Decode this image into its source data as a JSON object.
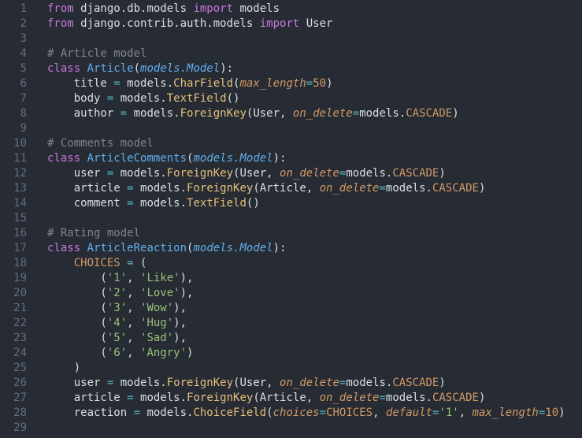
{
  "editor": {
    "language": "python",
    "colors": {
      "background": "#272b33",
      "line_number": "#636d83",
      "default": "#dcdfe4",
      "keyword": "#c678dd",
      "comment": "#7f848e",
      "class_name": "#61afef",
      "call": "#e5c07b",
      "number": "#d19a66",
      "string": "#98c379",
      "operator": "#56b6c2"
    },
    "lines": [
      {
        "n": "1",
        "tokens": [
          [
            "k",
            "from"
          ],
          [
            "d",
            " django.db.models "
          ],
          [
            "k",
            "import"
          ],
          [
            "d",
            " models"
          ]
        ]
      },
      {
        "n": "2",
        "tokens": [
          [
            "k",
            "from"
          ],
          [
            "d",
            " django.contrib.auth.models "
          ],
          [
            "k",
            "import"
          ],
          [
            "d",
            " User"
          ]
        ]
      },
      {
        "n": "3",
        "tokens": []
      },
      {
        "n": "4",
        "tokens": [
          [
            "c",
            "# Article model"
          ]
        ]
      },
      {
        "n": "5",
        "tokens": [
          [
            "k",
            "class"
          ],
          [
            "d",
            " "
          ],
          [
            "f",
            "Article"
          ],
          [
            "d",
            "("
          ],
          [
            "bi",
            "models.Model"
          ],
          [
            "d",
            "):"
          ]
        ]
      },
      {
        "n": "6",
        "tokens": [
          [
            "d",
            "    title "
          ],
          [
            "e",
            "="
          ],
          [
            "d",
            " models."
          ],
          [
            "b",
            "CharField"
          ],
          [
            "d",
            "("
          ],
          [
            "p",
            "max_length"
          ],
          [
            "e",
            "="
          ],
          [
            "y",
            "50"
          ],
          [
            "d",
            ")"
          ]
        ]
      },
      {
        "n": "7",
        "tokens": [
          [
            "d",
            "    body "
          ],
          [
            "e",
            "="
          ],
          [
            "d",
            " models."
          ],
          [
            "b",
            "TextField"
          ],
          [
            "d",
            "()"
          ]
        ]
      },
      {
        "n": "8",
        "tokens": [
          [
            "d",
            "    author "
          ],
          [
            "e",
            "="
          ],
          [
            "d",
            " models."
          ],
          [
            "b",
            "ForeignKey"
          ],
          [
            "d",
            "(User, "
          ],
          [
            "p",
            "on_delete"
          ],
          [
            "e",
            "="
          ],
          [
            "d",
            "models."
          ],
          [
            "y",
            "CASCADE"
          ],
          [
            "d",
            ")"
          ]
        ]
      },
      {
        "n": "9",
        "tokens": []
      },
      {
        "n": "10",
        "tokens": [
          [
            "c",
            "# Comments model"
          ]
        ]
      },
      {
        "n": "11",
        "tokens": [
          [
            "k",
            "class"
          ],
          [
            "d",
            " "
          ],
          [
            "f",
            "ArticleComments"
          ],
          [
            "d",
            "("
          ],
          [
            "bi",
            "models.Model"
          ],
          [
            "d",
            "):"
          ]
        ]
      },
      {
        "n": "12",
        "tokens": [
          [
            "d",
            "    user "
          ],
          [
            "e",
            "="
          ],
          [
            "d",
            " models."
          ],
          [
            "b",
            "ForeignKey"
          ],
          [
            "d",
            "(User, "
          ],
          [
            "p",
            "on_delete"
          ],
          [
            "e",
            "="
          ],
          [
            "d",
            "models."
          ],
          [
            "y",
            "CASCADE"
          ],
          [
            "d",
            ")"
          ]
        ]
      },
      {
        "n": "13",
        "tokens": [
          [
            "d",
            "    article "
          ],
          [
            "e",
            "="
          ],
          [
            "d",
            " models."
          ],
          [
            "b",
            "ForeignKey"
          ],
          [
            "d",
            "(Article, "
          ],
          [
            "p",
            "on_delete"
          ],
          [
            "e",
            "="
          ],
          [
            "d",
            "models."
          ],
          [
            "y",
            "CASCADE"
          ],
          [
            "d",
            ")"
          ]
        ]
      },
      {
        "n": "14",
        "tokens": [
          [
            "d",
            "    comment "
          ],
          [
            "e",
            "="
          ],
          [
            "d",
            " models."
          ],
          [
            "b",
            "TextField"
          ],
          [
            "d",
            "()"
          ]
        ]
      },
      {
        "n": "15",
        "tokens": []
      },
      {
        "n": "16",
        "tokens": [
          [
            "c",
            "# Rating model"
          ]
        ]
      },
      {
        "n": "17",
        "tokens": [
          [
            "k",
            "class"
          ],
          [
            "d",
            " "
          ],
          [
            "f",
            "ArticleReaction"
          ],
          [
            "d",
            "("
          ],
          [
            "bi",
            "models.Model"
          ],
          [
            "d",
            "):"
          ]
        ]
      },
      {
        "n": "18",
        "tokens": [
          [
            "d",
            "    "
          ],
          [
            "y",
            "CHOICES"
          ],
          [
            "d",
            " "
          ],
          [
            "e",
            "="
          ],
          [
            "d",
            " ("
          ]
        ]
      },
      {
        "n": "19",
        "tokens": [
          [
            "d",
            "        ("
          ],
          [
            "s",
            "'1'"
          ],
          [
            "d",
            ", "
          ],
          [
            "s",
            "'Like'"
          ],
          [
            "d",
            "),"
          ]
        ]
      },
      {
        "n": "20",
        "tokens": [
          [
            "d",
            "        ("
          ],
          [
            "s",
            "'2'"
          ],
          [
            "d",
            ", "
          ],
          [
            "s",
            "'Love'"
          ],
          [
            "d",
            "),"
          ]
        ]
      },
      {
        "n": "21",
        "tokens": [
          [
            "d",
            "        ("
          ],
          [
            "s",
            "'3'"
          ],
          [
            "d",
            ", "
          ],
          [
            "s",
            "'Wow'"
          ],
          [
            "d",
            "),"
          ]
        ]
      },
      {
        "n": "22",
        "tokens": [
          [
            "d",
            "        ("
          ],
          [
            "s",
            "'4'"
          ],
          [
            "d",
            ", "
          ],
          [
            "s",
            "'Hug'"
          ],
          [
            "d",
            "),"
          ]
        ]
      },
      {
        "n": "23",
        "tokens": [
          [
            "d",
            "        ("
          ],
          [
            "s",
            "'5'"
          ],
          [
            "d",
            ", "
          ],
          [
            "s",
            "'Sad'"
          ],
          [
            "d",
            "),"
          ]
        ]
      },
      {
        "n": "24",
        "tokens": [
          [
            "d",
            "        ("
          ],
          [
            "s",
            "'6'"
          ],
          [
            "d",
            ", "
          ],
          [
            "s",
            "'Angry'"
          ],
          [
            "d",
            ")"
          ]
        ]
      },
      {
        "n": "25",
        "tokens": [
          [
            "d",
            "    )"
          ]
        ]
      },
      {
        "n": "26",
        "tokens": [
          [
            "d",
            "    user "
          ],
          [
            "e",
            "="
          ],
          [
            "d",
            " models."
          ],
          [
            "b",
            "ForeignKey"
          ],
          [
            "d",
            "(User, "
          ],
          [
            "p",
            "on_delete"
          ],
          [
            "e",
            "="
          ],
          [
            "d",
            "models."
          ],
          [
            "y",
            "CASCADE"
          ],
          [
            "d",
            ")"
          ]
        ]
      },
      {
        "n": "27",
        "tokens": [
          [
            "d",
            "    article "
          ],
          [
            "e",
            "="
          ],
          [
            "d",
            " models."
          ],
          [
            "b",
            "ForeignKey"
          ],
          [
            "d",
            "(Article, "
          ],
          [
            "p",
            "on_delete"
          ],
          [
            "e",
            "="
          ],
          [
            "d",
            "models."
          ],
          [
            "y",
            "CASCADE"
          ],
          [
            "d",
            ")"
          ]
        ]
      },
      {
        "n": "28",
        "tokens": [
          [
            "d",
            "    reaction "
          ],
          [
            "e",
            "="
          ],
          [
            "d",
            " models."
          ],
          [
            "b",
            "ChoiceField"
          ],
          [
            "d",
            "("
          ],
          [
            "p",
            "choices"
          ],
          [
            "e",
            "="
          ],
          [
            "y",
            "CHOICES"
          ],
          [
            "d",
            ", "
          ],
          [
            "p",
            "default"
          ],
          [
            "e",
            "="
          ],
          [
            "s",
            "'1'"
          ],
          [
            "d",
            ", "
          ],
          [
            "p",
            "max_length"
          ],
          [
            "e",
            "="
          ],
          [
            "y",
            "10"
          ],
          [
            "d",
            ")"
          ]
        ]
      },
      {
        "n": "29",
        "tokens": []
      }
    ]
  }
}
